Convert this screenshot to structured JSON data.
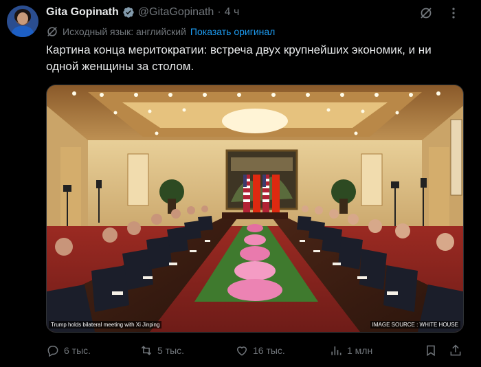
{
  "author": {
    "name": "Gita Gopinath",
    "handle": "@GitaGopinath",
    "separator": "·",
    "time": "4 ч"
  },
  "translation": {
    "note": "Исходный язык: английский",
    "show_original": "Показать оригинал"
  },
  "tweet_text": "Картина конца меритократии: встреча двух крупнейших экономик, и ни одной женщины за столом.",
  "media": {
    "caption": "Trump holds bilateral meeting with Xi Jinping",
    "source": "IMAGE SOURCE : WHITE HOUSE"
  },
  "actions": {
    "replies": "6 тыс.",
    "reposts": "5 тыс.",
    "likes": "16 тыс.",
    "views": "1 млн"
  },
  "colors": {
    "background": "#000000",
    "text": "#e7e9ea",
    "muted": "#71767b",
    "link": "#1d9bf0"
  },
  "icons": [
    "verified-badge-icon",
    "grok-icon",
    "more-icon",
    "translate-icon",
    "reply-icon",
    "repost-icon",
    "like-icon",
    "views-icon",
    "bookmark-icon",
    "share-icon"
  ]
}
